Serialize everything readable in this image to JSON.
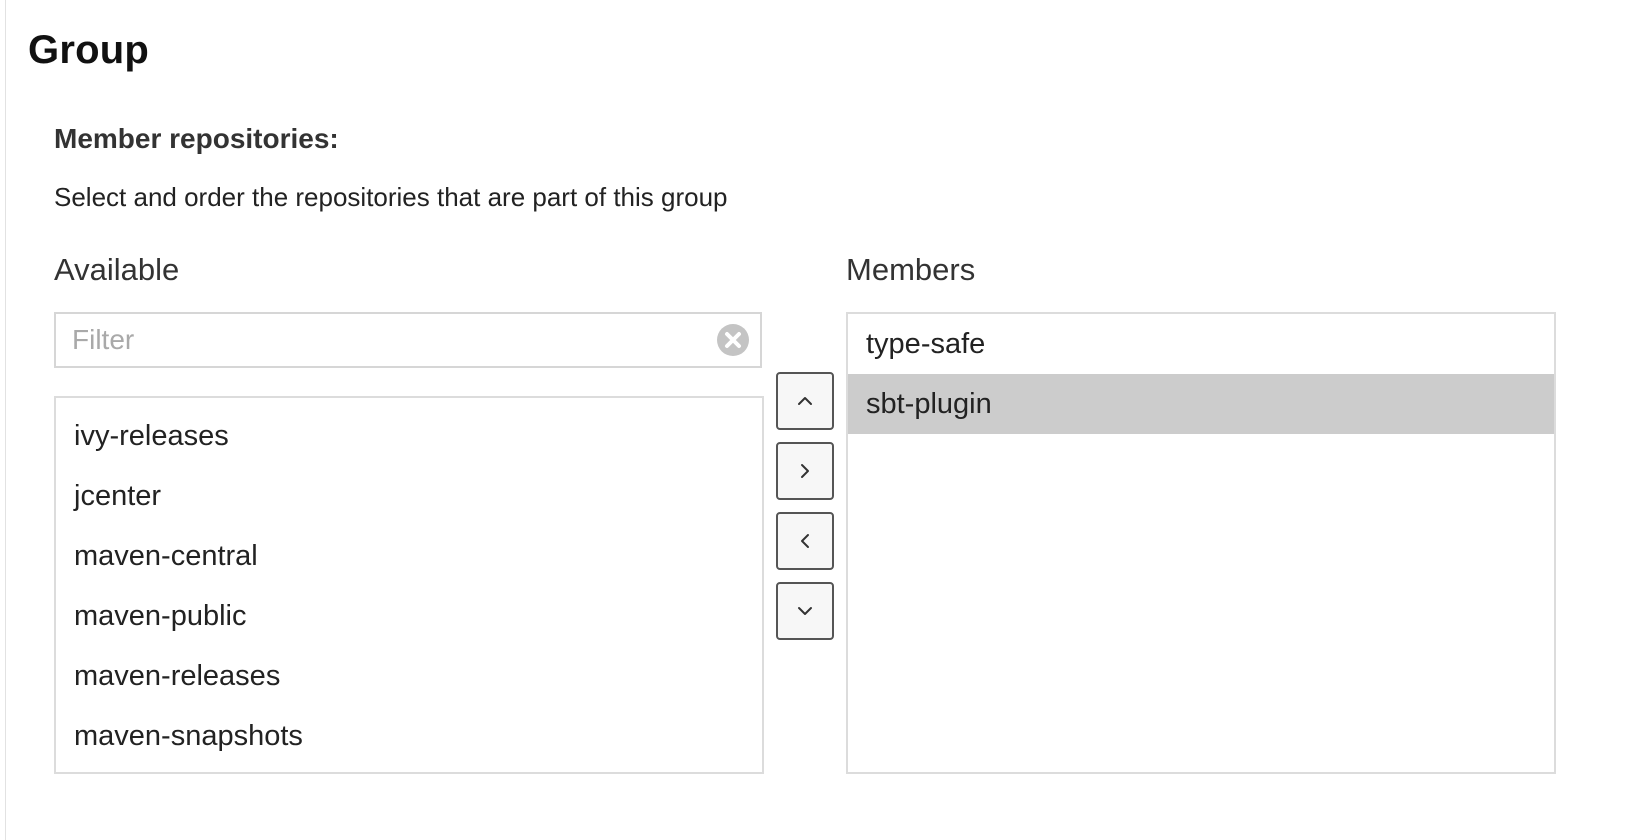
{
  "page": {
    "title": "Group"
  },
  "members_section": {
    "label": "Member repositories:",
    "description": "Select and order the repositories that are part of this group"
  },
  "available": {
    "heading": "Available",
    "filter_placeholder": "Filter",
    "filter_value": "",
    "items": [
      "ivy-releases",
      "jcenter",
      "maven-central",
      "maven-public",
      "maven-releases",
      "maven-snapshots"
    ]
  },
  "members": {
    "heading": "Members",
    "items": [
      "type-safe",
      "sbt-plugin"
    ],
    "selected_item": "sbt-plugin"
  },
  "buttons": {
    "move_up_icon": "chevron-up-icon",
    "add_icon": "chevron-right-icon",
    "remove_icon": "chevron-left-icon",
    "move_down_icon": "chevron-down-icon"
  },
  "colors": {
    "selected_row": "#cccccc",
    "border": "#dcdcdc",
    "clear_icon": "#c4c4c4"
  }
}
